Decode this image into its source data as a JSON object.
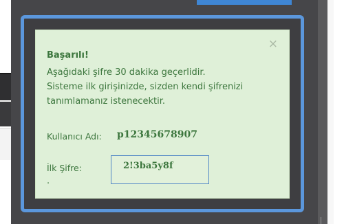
{
  "alert": {
    "title": "Başarılı!",
    "message_lines": [
      "Aşağıdaki şifre 30 dakika geçerlidir.",
      "Sisteme ilk girişinizde, sizden kendi şifrenizi",
      "tanımlamanız istenecektir."
    ],
    "username_label": "Kullanıcı Adı:",
    "username_value": "p12345678907",
    "password_label": "İlk Şifre:",
    "password_value": "2!3ba5y8f",
    "trailing_text": ".",
    "close_symbol": "×"
  },
  "colors": {
    "alert_background": "#dff0d8",
    "alert_text": "#3c763d",
    "dialog_border": "#5b97dc",
    "overlay": "#464649",
    "password_box_border": "#4f86c6"
  }
}
